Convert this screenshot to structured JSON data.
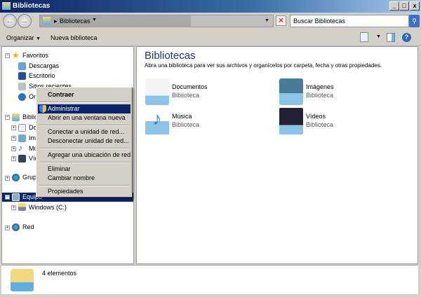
{
  "window": {
    "title": "Bibliotecas",
    "minimize": "_",
    "maximize": "□",
    "close": "x"
  },
  "address": {
    "path": "Bibliotecas",
    "search_placeholder": "Buscar Bibliotecas"
  },
  "toolbar": {
    "organize": "Organizar",
    "new_library": "Nueva biblioteca"
  },
  "nav": {
    "favorites": "Favoritos",
    "fav_items": [
      "Descargas",
      "Escritorio",
      "Sitios recientes",
      "One"
    ],
    "libraries": "Biblio",
    "lib_items": [
      "Doc",
      "Imá",
      "Mús",
      "Víde"
    ],
    "homegroup": "Grupo",
    "computer": "Equipo",
    "drive": "Windows (C:)",
    "network": "Red"
  },
  "context_menu": {
    "items": [
      "Contraer",
      "Administrar",
      "Abrir en una ventana nueva",
      "Conectar a unidad de red...",
      "Desconectar unidad de red...",
      "Agregar una ubicación de red",
      "Eliminar",
      "Cambiar nombre",
      "Propiedades"
    ]
  },
  "content": {
    "title": "Bibliotecas",
    "subtitle": "Abra una biblioteca para ver sus archivos y organícelos por carpeta, fecha y otras propiedades.",
    "libraries": [
      {
        "name": "Documentos",
        "type": "Biblioteca"
      },
      {
        "name": "Imágenes",
        "type": "Biblioteca"
      },
      {
        "name": "Música",
        "type": "Biblioteca"
      },
      {
        "name": "Vídeos",
        "type": "Biblioteca"
      }
    ]
  },
  "status": {
    "count": "4 elementos"
  },
  "colors": {
    "selection": "#0a246a",
    "titlebar": "#0a246a"
  }
}
